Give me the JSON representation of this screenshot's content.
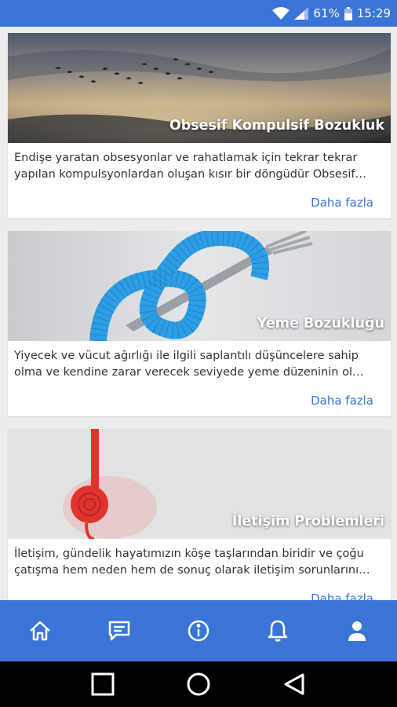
{
  "status_bar": {
    "battery_percent": "61%",
    "time": "15:29",
    "icons": [
      "wifi-icon",
      "signal-icon",
      "battery-icon"
    ]
  },
  "colors": {
    "primary": "#3a74d6",
    "link": "#3a74d6",
    "background": "#ededed"
  },
  "cards": [
    {
      "title": "Obsesif Kompulsif Bozukluk",
      "description": "Endişe yaratan obsesyonlar ve rahatlamak için tekrar tekrar yapılan kompulsyonlardan oluşan kısır bir döngüdür Obsesif…",
      "more_label": "Daha fazla"
    },
    {
      "title": "Yeme Bozukluğu",
      "description": "Yiyecek ve vücut ağırlığı ile ilgili saplantılı düşüncelere sahip olma ve kendine zarar verecek seviyede yeme düzeninin ol…",
      "more_label": "Daha fazla"
    },
    {
      "title": "İletişim Problemleri",
      "description": "İletişim, gündelik hayatımızın köşe taşlarından biridir ve çoğu çatışma hem neden hem de sonuç olarak iletişim sorunlarını…",
      "more_label": "Daha fazla"
    }
  ],
  "bottom_nav": {
    "items": [
      "home-icon",
      "chat-icon",
      "info-icon",
      "bell-icon",
      "profile-icon"
    ],
    "active": "info-icon"
  },
  "system_nav": [
    "recent-apps-icon",
    "home-circle-icon",
    "back-triangle-icon"
  ]
}
